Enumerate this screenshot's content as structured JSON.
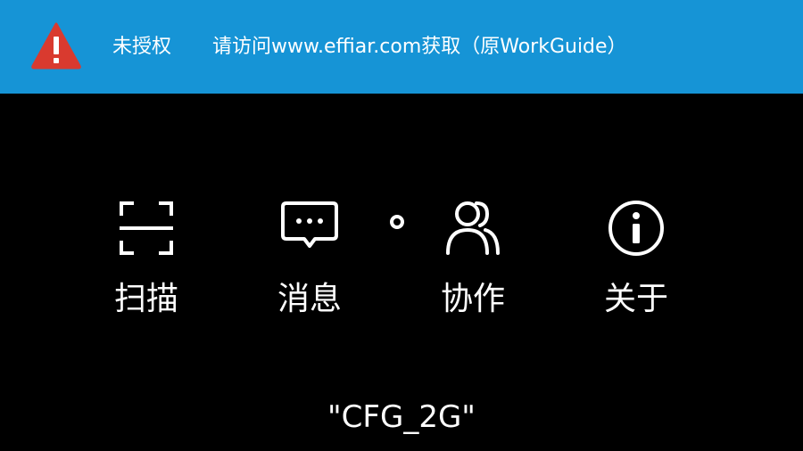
{
  "banner": {
    "background": "#1694d6",
    "icon": "warning-triangle-icon",
    "icon_color": "#d93a2f",
    "status": "未授权",
    "message": "请访问www.effiar.com获取（原WorkGuide）"
  },
  "menu": {
    "items": [
      {
        "id": "scan",
        "icon": "scan-frame-icon",
        "label": "扫描"
      },
      {
        "id": "message",
        "icon": "message-bubble-icon",
        "label": "消息"
      },
      {
        "id": "collaborate",
        "icon": "users-icon",
        "label": "协作"
      },
      {
        "id": "about",
        "icon": "info-icon",
        "label": "关于"
      }
    ],
    "indicator": "status-dot-icon"
  },
  "network": {
    "ssid": "\"CFG_2G\""
  }
}
